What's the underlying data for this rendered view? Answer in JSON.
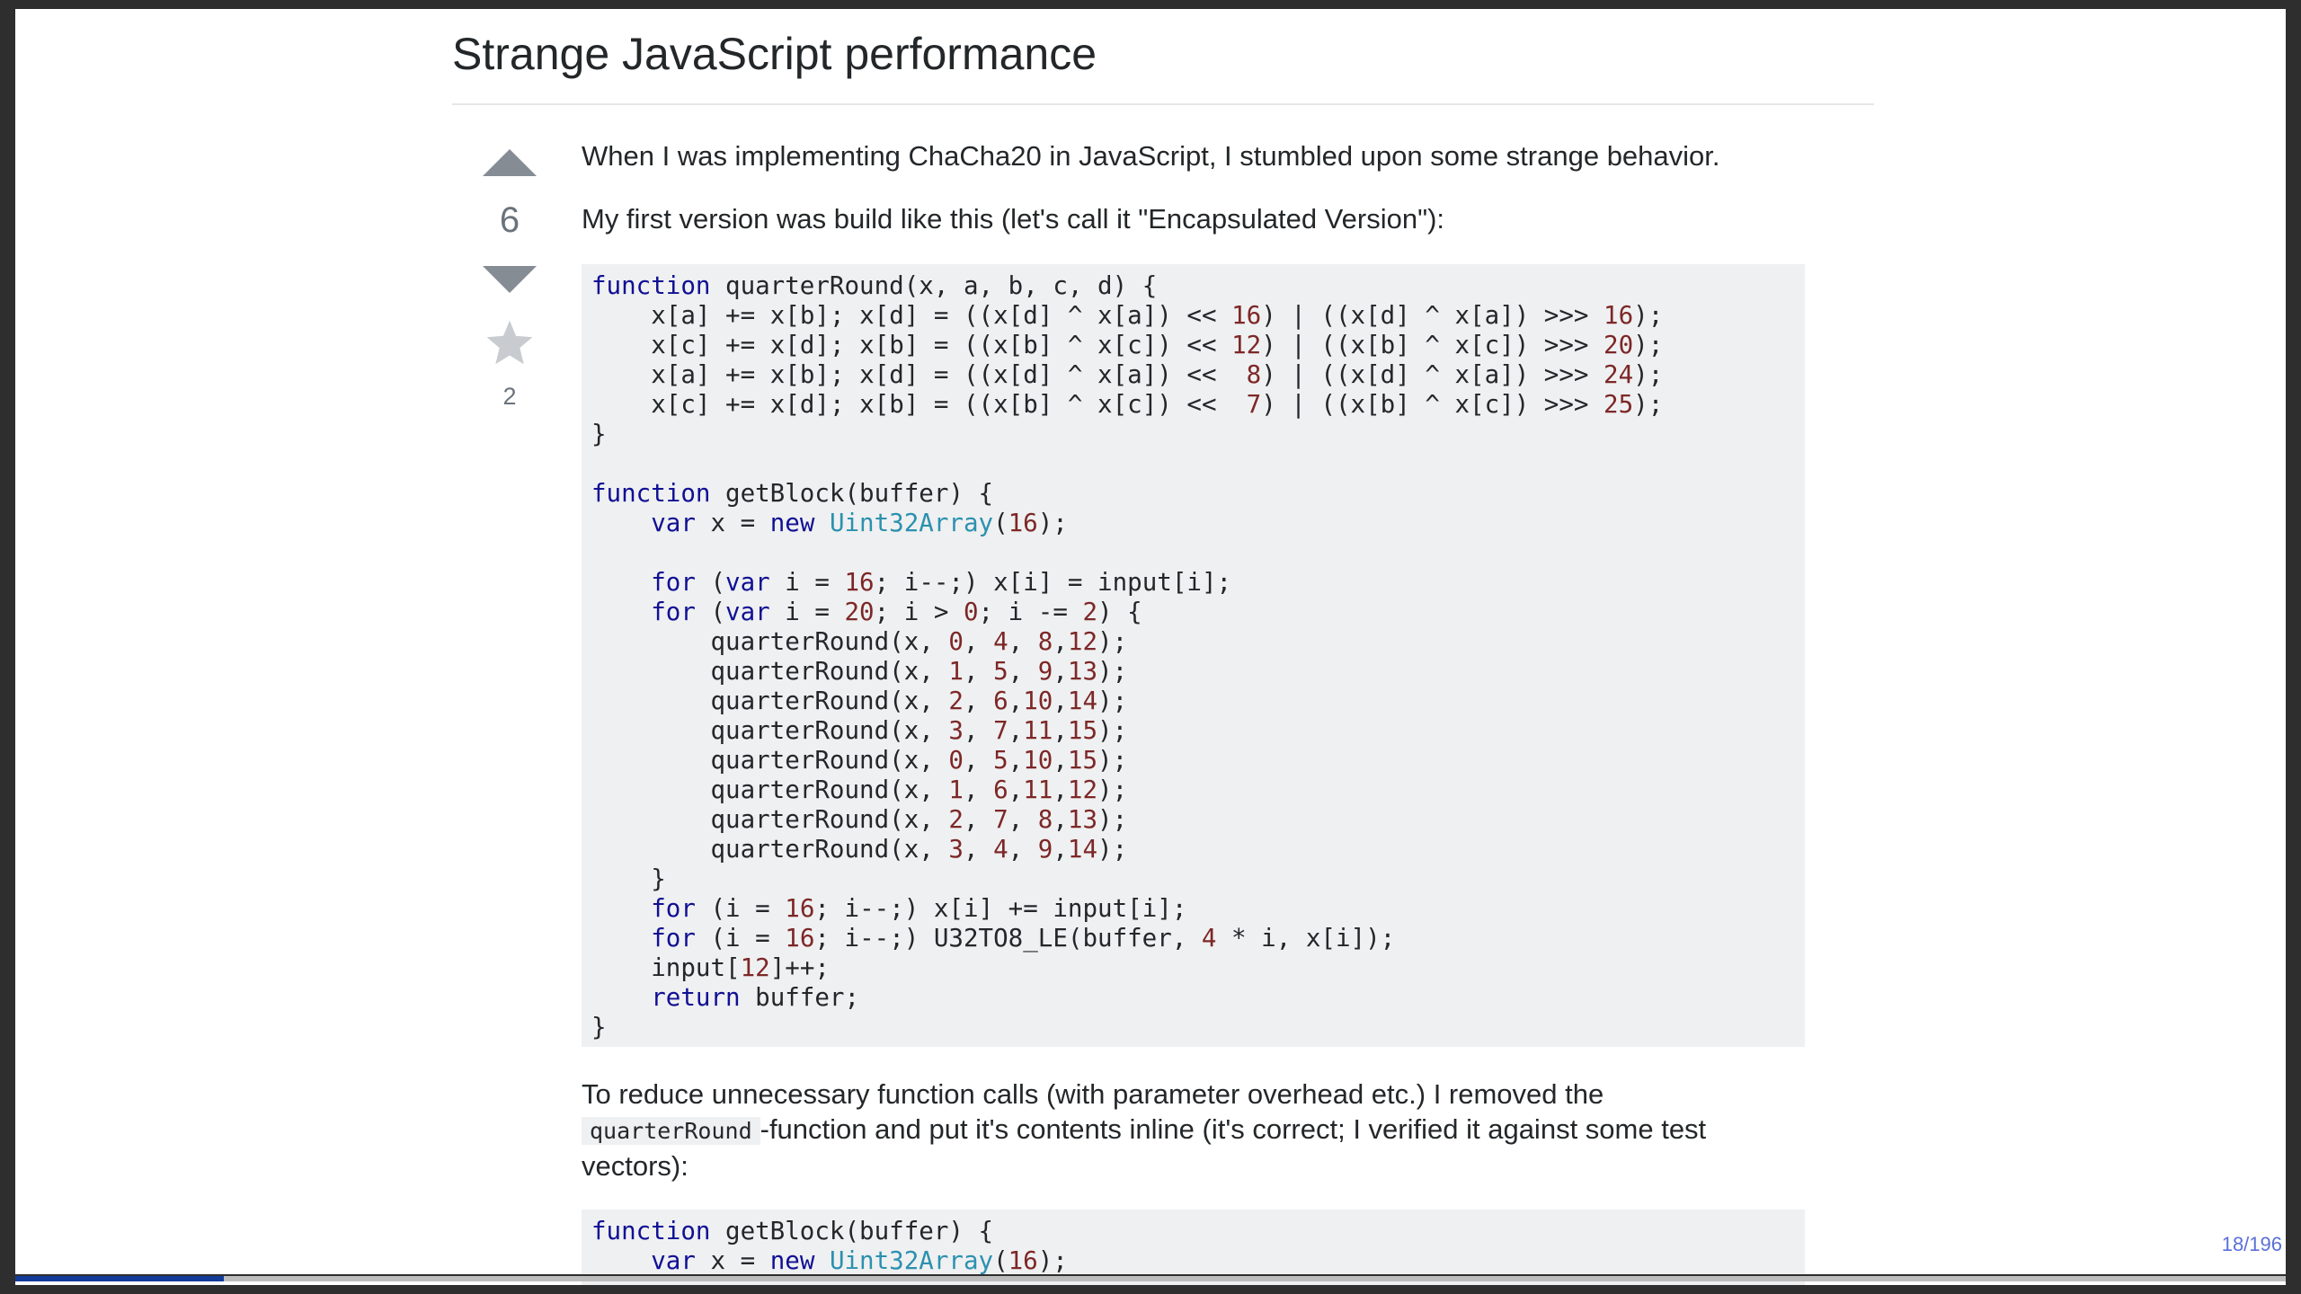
{
  "question": {
    "title": "Strange JavaScript performance",
    "vote_count": "6",
    "favorite_count": "2",
    "paragraphs": [
      "When I was implementing ChaCha20 in JavaScript, I stumbled upon some strange behavior.",
      "My first version was build like this (let's call it \"Encapsulated Version\"):"
    ],
    "paragraph3": {
      "before": "To reduce unnecessary function calls (with parameter overhead etc.) I removed the",
      "code": "quarterRound",
      "after": "-function and put it's contents inline (it's correct; I verified it against some test vectors):"
    }
  },
  "code_block_1": [
    "function quarterRound(x, a, b, c, d) {",
    "    x[a] += x[b]; x[d] = ((x[d] ^ x[a]) << 16) | ((x[d] ^ x[a]) >>> 16);",
    "    x[c] += x[d]; x[b] = ((x[b] ^ x[c]) << 12) | ((x[b] ^ x[c]) >>> 20);",
    "    x[a] += x[b]; x[d] = ((x[d] ^ x[a]) <<  8) | ((x[d] ^ x[a]) >>> 24);",
    "    x[c] += x[d]; x[b] = ((x[b] ^ x[c]) <<  7) | ((x[b] ^ x[c]) >>> 25);",
    "}",
    "",
    "function getBlock(buffer) {",
    "    var x = new Uint32Array(16);",
    "",
    "    for (var i = 16; i--;) x[i] = input[i];",
    "    for (var i = 20; i > 0; i -= 2) {",
    "        quarterRound(x, 0, 4, 8,12);",
    "        quarterRound(x, 1, 5, 9,13);",
    "        quarterRound(x, 2, 6,10,14);",
    "        quarterRound(x, 3, 7,11,15);",
    "        quarterRound(x, 0, 5,10,15);",
    "        quarterRound(x, 1, 6,11,12);",
    "        quarterRound(x, 2, 7, 8,13);",
    "        quarterRound(x, 3, 4, 9,14);",
    "    }",
    "    for (i = 16; i--;) x[i] += input[i];",
    "    for (i = 16; i--;) U32TO8_LE(buffer, 4 * i, x[i]);",
    "    input[12]++;",
    "    return buffer;",
    "}"
  ],
  "code_block_2": [
    "function getBlock(buffer) {",
    "    var x = new Uint32Array(16);"
  ],
  "slide": {
    "page_indicator": "18/196",
    "progress_fraction": 0.0918
  },
  "colors": {
    "keyword": "#101094",
    "number": "#7d2727",
    "type": "#2b91af",
    "code_background": "#eff0f1",
    "vote_arrow": "#858c93",
    "page_indicator": "#5b6fd8",
    "progress": "#123b9a"
  },
  "icons": {
    "upvote": "triangle-up-icon",
    "downvote": "triangle-down-icon",
    "favorite": "star-icon"
  }
}
